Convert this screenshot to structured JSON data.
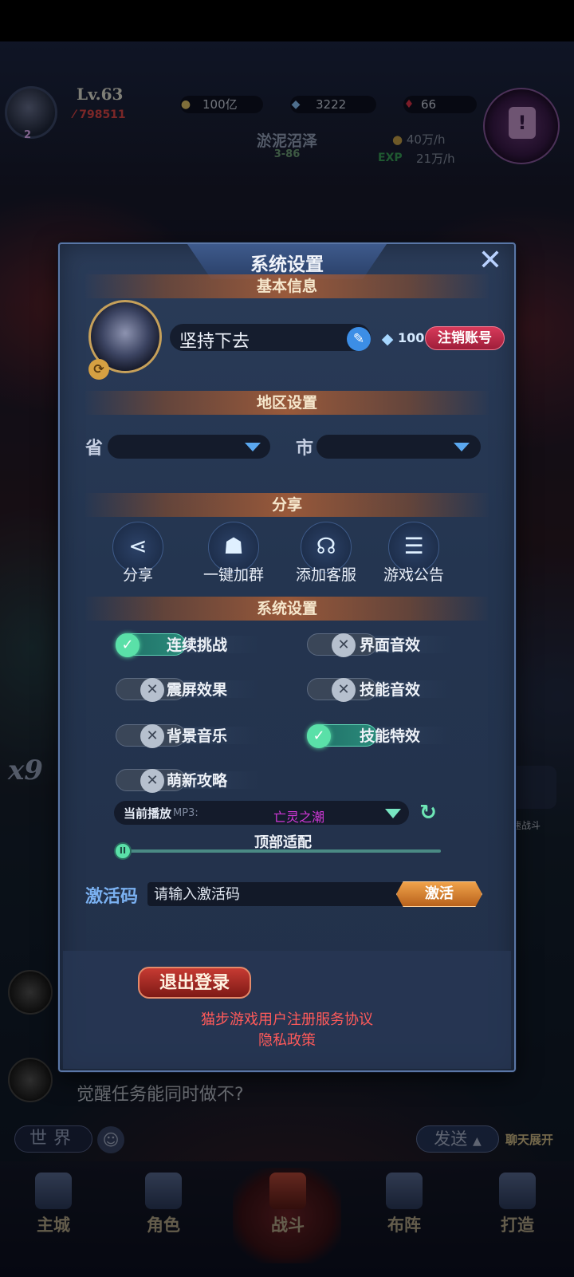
{
  "hud": {
    "level": "Lv.63",
    "power": "798511",
    "gold": "100亿",
    "diamond": "3222",
    "ruby": "66",
    "stage_name": "淤泥沼泽",
    "stage_num": "3-86",
    "gold_rate": "40万/h",
    "exp_label": "EXP",
    "exp_rate": "21万/h",
    "avatar_badge": "2"
  },
  "side": {
    "multiplier": "x9",
    "quick_battle": "快速战斗"
  },
  "chat": {
    "message": "觉醒任务能同时做不?",
    "world_tab": "世界",
    "send": "发送",
    "expand": "聊天展开"
  },
  "nav": {
    "items": [
      "主城",
      "角色",
      "战斗",
      "布阵",
      "打造"
    ]
  },
  "dialog": {
    "title": "系统设置",
    "sections": {
      "basic": "基本信息",
      "region": "地区设置",
      "share": "分享",
      "system": "系统设置"
    },
    "profile": {
      "name": "坚持下去",
      "rename_cost": "100",
      "cancel_account": "注销账号"
    },
    "region": {
      "province_label": "省",
      "city_label": "市",
      "province_value": "",
      "city_value": ""
    },
    "share_buttons": [
      {
        "label": "分享",
        "icon": "share-icon"
      },
      {
        "label": "一键加群",
        "icon": "qq-penguin-icon"
      },
      {
        "label": "添加客服",
        "icon": "headset-icon"
      },
      {
        "label": "游戏公告",
        "icon": "notice-icon"
      }
    ],
    "toggles": [
      {
        "label": "连续挑战",
        "on": true
      },
      {
        "label": "界面音效",
        "on": false
      },
      {
        "label": "震屏效果",
        "on": false
      },
      {
        "label": "技能音效",
        "on": false
      },
      {
        "label": "背景音乐",
        "on": false
      },
      {
        "label": "技能特效",
        "on": true
      },
      {
        "label": "萌新攻略",
        "on": false
      }
    ],
    "music": {
      "label": "当前播放",
      "format": "MP3:",
      "track": "亡灵之潮"
    },
    "top_fit": {
      "label": "顶部适配",
      "value": 0
    },
    "activation": {
      "label": "激活码",
      "placeholder": "请输入激活码",
      "button": "激活"
    },
    "logout": "退出登录",
    "links": [
      "猫步游戏用户注册服务协议",
      "隐私政策"
    ]
  },
  "colors": {
    "dialog_bg": "#243550",
    "section_accent": "#be6432",
    "toggle_on": "#5ae0a8",
    "toggle_off": "#b6c0ce",
    "danger": "#c63a32",
    "link": "#ff5a5a",
    "track_name": "#d238d8"
  }
}
